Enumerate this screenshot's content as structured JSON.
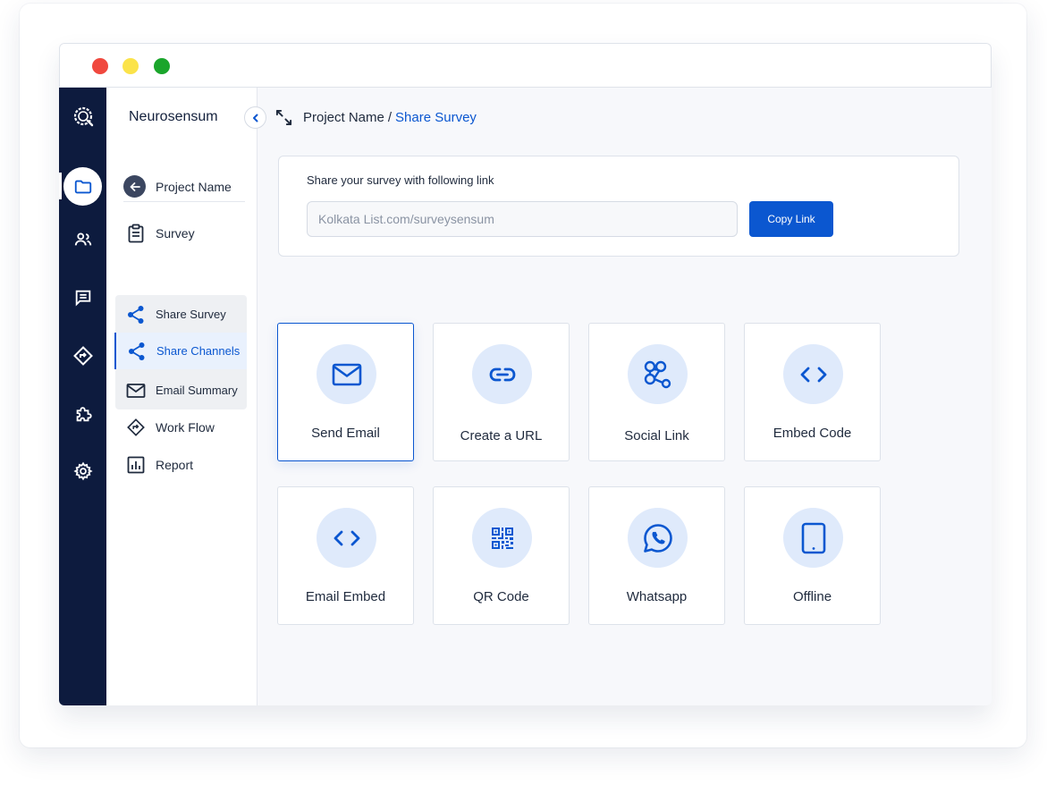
{
  "app": {
    "brand": "Neurosensum"
  },
  "sidebar": {
    "back_label": "Project Name",
    "items": [
      {
        "label": "Survey",
        "icon": "clipboard-icon"
      },
      {
        "label": "Share Survey",
        "icon": "share-icon"
      },
      {
        "label": "Share Channels",
        "icon": "share-icon",
        "active": true
      },
      {
        "label": "Email Summary",
        "icon": "mail-icon"
      },
      {
        "label": "Work Flow",
        "icon": "workflow-icon"
      },
      {
        "label": "Report",
        "icon": "report-icon"
      }
    ]
  },
  "rail": {
    "icons": [
      "logo-icon",
      "folder-icon",
      "users-icon",
      "chat-icon",
      "direction-icon",
      "puzzle-icon",
      "gear-icon"
    ],
    "active": "folder-icon"
  },
  "breadcrumb": {
    "parent": "Project Name",
    "separator": "/",
    "current": "Share Survey"
  },
  "share_link": {
    "title": "Share your survey with following link",
    "value": "Kolkata List.com/surveysensum",
    "copy_label": "Copy Link"
  },
  "channels": [
    {
      "label": "Send Email",
      "icon": "mail-icon",
      "selected": true
    },
    {
      "label": "Create a URL",
      "icon": "link-icon"
    },
    {
      "label": "Social Link",
      "icon": "social-icon"
    },
    {
      "label": "Embed Code",
      "icon": "code-icon"
    },
    {
      "label": "Email Embed",
      "icon": "code-icon"
    },
    {
      "label": "QR Code",
      "icon": "qr-icon"
    },
    {
      "label": "Whatsapp",
      "icon": "whatsapp-icon"
    },
    {
      "label": "Offline",
      "icon": "tablet-icon"
    }
  ],
  "colors": {
    "accent": "#0b57d0",
    "rail": "#0d1b3e",
    "icon_bg": "#dfeafb"
  }
}
